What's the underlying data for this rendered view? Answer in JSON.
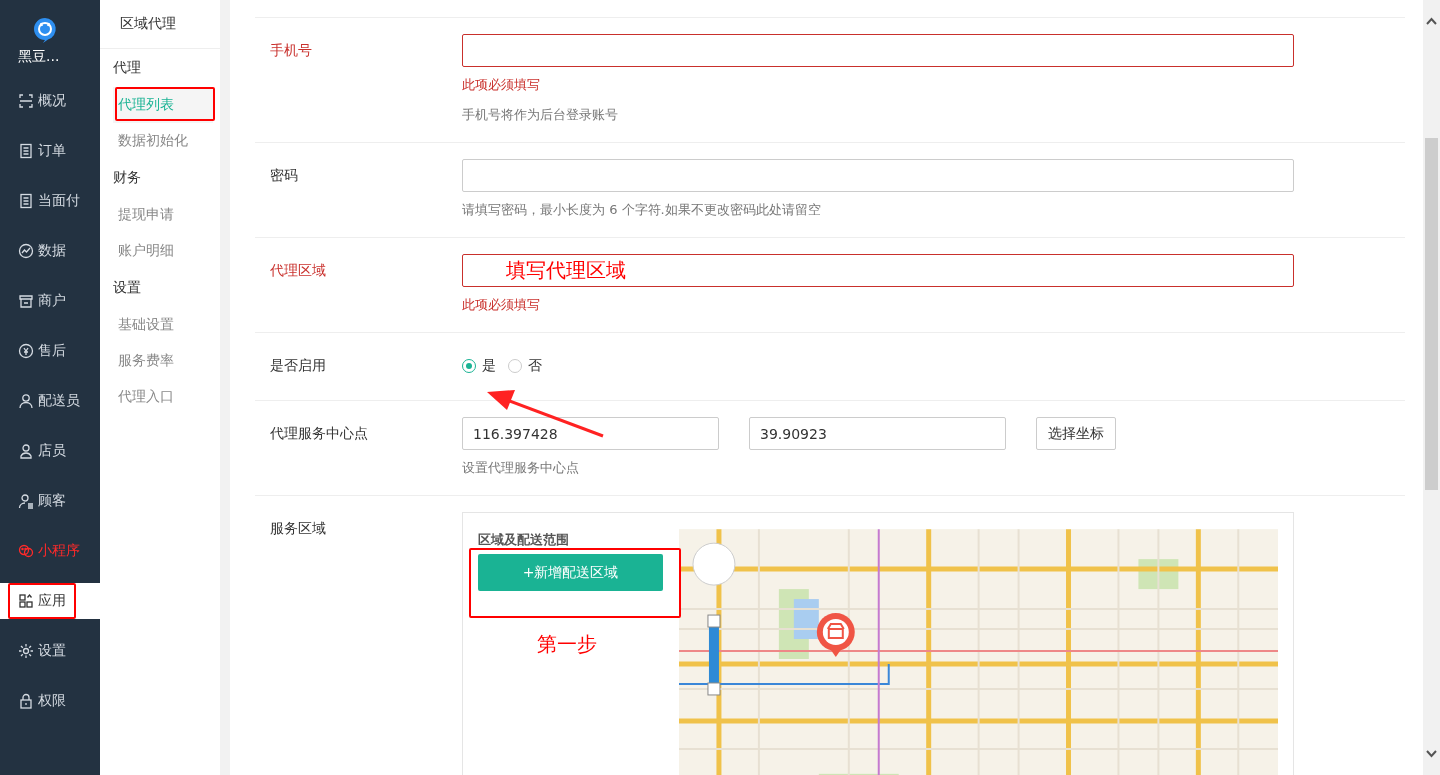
{
  "sidebar": {
    "brand": "黑豆...",
    "items": [
      {
        "label": "概况",
        "selected": false,
        "highlighted": false,
        "color": "#d5dbe2"
      },
      {
        "label": "订单",
        "selected": false,
        "highlighted": false,
        "color": "#d5dbe2"
      },
      {
        "label": "当面付",
        "selected": false,
        "highlighted": false,
        "color": "#d5dbe2"
      },
      {
        "label": "数据",
        "selected": false,
        "highlighted": false,
        "color": "#d5dbe2"
      },
      {
        "label": "商户",
        "selected": false,
        "highlighted": false,
        "color": "#d5dbe2"
      },
      {
        "label": "售后",
        "selected": false,
        "highlighted": false,
        "color": "#d5dbe2"
      },
      {
        "label": "配送员",
        "selected": false,
        "highlighted": false,
        "color": "#d5dbe2"
      },
      {
        "label": "店员",
        "selected": false,
        "highlighted": false,
        "color": "#d5dbe2"
      },
      {
        "label": "顾客",
        "selected": false,
        "highlighted": false,
        "color": "#d5dbe2"
      },
      {
        "label": "小程序",
        "selected": false,
        "highlighted": false,
        "color": "#ff2a2a"
      },
      {
        "label": "应用",
        "selected": true,
        "highlighted": true,
        "color": "#333333"
      },
      {
        "label": "设置",
        "selected": false,
        "highlighted": false,
        "color": "#d5dbe2"
      },
      {
        "label": "权限",
        "selected": false,
        "highlighted": false,
        "color": "#d5dbe2"
      }
    ]
  },
  "subnav": {
    "title": "区域代理",
    "groups": [
      {
        "title": "代理",
        "items": [
          {
            "label": "代理列表",
            "selected": true,
            "highlighted": true
          },
          {
            "label": "数据初始化",
            "selected": false,
            "highlighted": false
          }
        ]
      },
      {
        "title": "财务",
        "items": [
          {
            "label": "提现申请",
            "selected": false,
            "highlighted": false
          },
          {
            "label": "账户明细",
            "selected": false,
            "highlighted": false
          }
        ]
      },
      {
        "title": "设置",
        "items": [
          {
            "label": "基础设置",
            "selected": false,
            "highlighted": false
          },
          {
            "label": "服务费率",
            "selected": false,
            "highlighted": false
          },
          {
            "label": "代理入口",
            "selected": false,
            "highlighted": false
          }
        ]
      }
    ]
  },
  "form": {
    "rows": [
      {
        "kind": "text",
        "label": "手机号",
        "error": true,
        "error_text": "此项必须填写",
        "help": "手机号将作为后台登录账号"
      },
      {
        "kind": "text",
        "label": "密码",
        "error": false,
        "help": "请填写密码，最小长度为 6 个字符.如果不更改密码此处请留空"
      },
      {
        "kind": "text",
        "label": "代理区域",
        "error": true,
        "annotation": "填写代理区域",
        "error_text": "此项必须填写"
      },
      {
        "kind": "radio",
        "label": "是否启用",
        "options": [
          {
            "label": "是",
            "selected": true
          },
          {
            "label": "否",
            "selected": false
          }
        ]
      },
      {
        "kind": "coords",
        "label": "代理服务中心点",
        "values": [
          "116.397428",
          "39.90923"
        ],
        "button": "选择坐标",
        "help": "设置代理服务中心点"
      },
      {
        "kind": "map",
        "label": "服务区域",
        "title": "区域及配送范围",
        "button": "+新增配送区域",
        "annotation": "第一步"
      }
    ]
  }
}
